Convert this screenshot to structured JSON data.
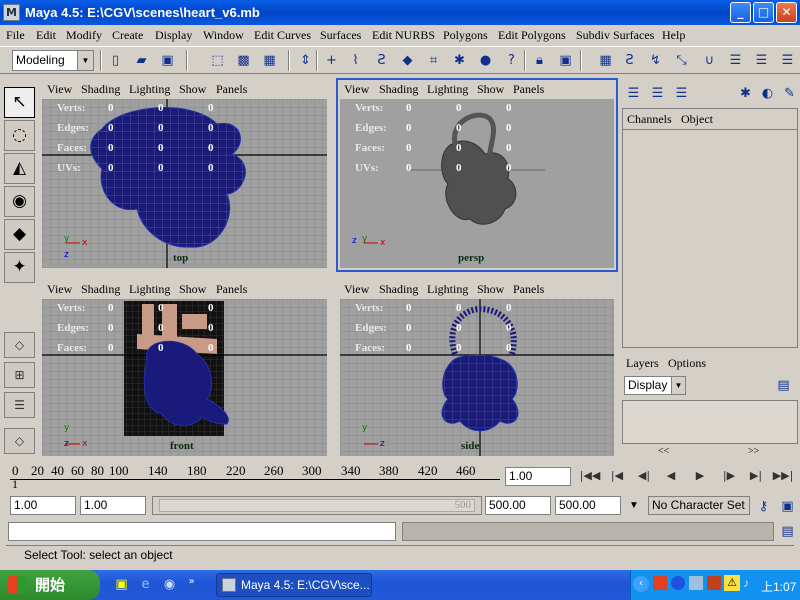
{
  "window": {
    "title": "Maya 4.5: E:\\CGV\\scenes\\heart_v6.mb",
    "buttons": [
      "minimize-button",
      "maximize-button",
      "close-button"
    ]
  },
  "menu": [
    "File",
    "Edit",
    "Modify",
    "Create",
    "Display",
    "Window",
    "Edit Curves",
    "Surfaces",
    "Edit NURBS",
    "Polygons",
    "Edit Polygons",
    "Subdiv Surfaces",
    "Help"
  ],
  "toolbar": {
    "mode": "Modeling"
  },
  "viewport_menu": [
    "View",
    "Shading",
    "Lighting",
    "Show",
    "Panels"
  ],
  "hud_labels": [
    "Verts:",
    "Edges:",
    "Faces:",
    "UVs:"
  ],
  "viewports": [
    {
      "camera": "top",
      "values": [
        "0",
        "0",
        "0"
      ]
    },
    {
      "camera": "persp",
      "values": [
        "0",
        "0",
        "0"
      ]
    },
    {
      "camera": "front",
      "values": [
        "0",
        "0",
        "0"
      ]
    },
    {
      "camera": "side",
      "values": [
        "0",
        "0",
        "0"
      ]
    }
  ],
  "channel_box": {
    "channels": "Channels",
    "object": "Object"
  },
  "layers": {
    "layers": "Layers",
    "options": "Options",
    "display": "Display",
    "prev": "<<",
    "next": ">>"
  },
  "timeline": {
    "ticks": [
      "0",
      "20",
      "40",
      "60",
      "80",
      "100",
      "140",
      "180",
      "220",
      "260",
      "300",
      "340",
      "380",
      "420",
      "460"
    ],
    "marker": "1",
    "current_frame": "1.00"
  },
  "range": {
    "start": "1.00",
    "start2": "1.00",
    "slider_end": "500",
    "end": "500.00",
    "end2": "500.00",
    "character_set": "No Character Set"
  },
  "help_line": "Select Tool: select an object",
  "taskbar": {
    "start": "開始",
    "task": "Maya 4.5: E:\\CGV\\sce...",
    "clock": "上1:07"
  }
}
